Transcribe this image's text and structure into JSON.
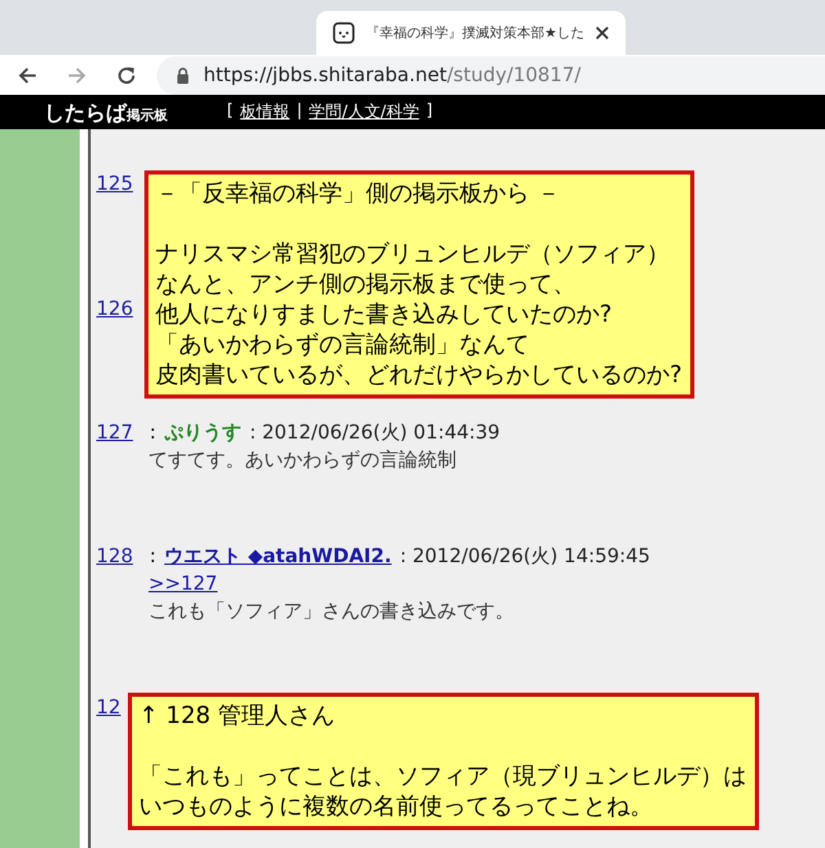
{
  "browser": {
    "tab_title": "『幸福の科学』撲滅対策本部★した",
    "url_host": "https://jbbs.shitaraba.net",
    "url_path": "/study/10817/"
  },
  "header": {
    "logo_main": "したらば",
    "logo_sub": "掲示板",
    "open_bracket": "[",
    "links": [
      "板情報",
      "学問/人文/科学"
    ],
    "separator": "|",
    "close_bracket": "]"
  },
  "posts": [
    {
      "number": "125"
    },
    {
      "number": "126"
    },
    {
      "number": "127",
      "colon": ":",
      "name": "ぷりうす",
      "name_link": false,
      "date": ": 2012/06/26(火) 01:44:39",
      "lines": [
        "てすてす。あいかわらずの言論統制"
      ]
    },
    {
      "number": "128",
      "colon": ":",
      "name": "ウエスト ◆atahWDAI2.",
      "name_link": true,
      "date": ": 2012/06/26(火) 14:59:45",
      "reply": ">>127",
      "lines": [
        "これも「ソフィア」さんの書き込みです。"
      ]
    },
    {
      "number": "12"
    }
  ],
  "callouts": [
    {
      "heading": "－「反幸福の科学」側の掲示板から －",
      "lines": [
        "ナリスマシ常習犯のブリュンヒルデ（ソフィア）",
        "なんと、アンチ側の掲示板まで使って、",
        "他人になりすました書き込みしていたのか?",
        "「あいかわらずの言論統制」なんて",
        "皮肉書いているが、どれだけやらかしているのか?"
      ]
    },
    {
      "heading": "↑ 128 管理人さん",
      "lines": [
        "「これも」ってことは、ソフィア（現ブリュンヒルデ）は",
        "いつものように複数の名前使ってるってことね。"
      ]
    }
  ]
}
